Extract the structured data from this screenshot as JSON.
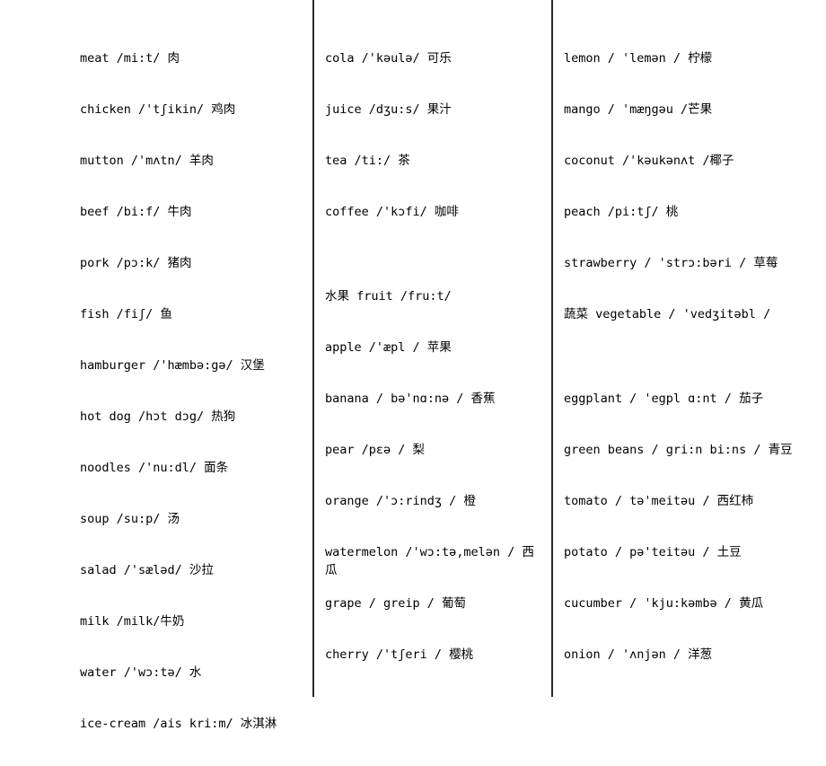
{
  "document": {
    "type": "vocabulary-word-list",
    "background_color": "#ffffff",
    "text_color": "#000000",
    "divider_color": "#2b2b2b",
    "column_count": 3
  },
  "columns": [
    {
      "name": "food-meat-and-dishes",
      "entries": [
        {
          "word": "meat",
          "text": "meat    /mi:t/ 肉"
        },
        {
          "word": "chicken",
          "text": "chicken    /'tʃikin/ 鸡肉"
        },
        {
          "word": "mutton",
          "text": "mutton    /'mʌtn/ 羊肉"
        },
        {
          "word": "beef",
          "text": "beef    /bi:f/ 牛肉"
        },
        {
          "word": "pork",
          "text": "pork    /pɔ:k/ 猪肉"
        },
        {
          "word": "fish",
          "text": "fish    /fiʃ/ 鱼"
        },
        {
          "word": "hamburger",
          "text": "hamburger    /'hæmbə:gə/ 汉堡"
        },
        {
          "word": "hot dog",
          "text": "hot dog    /hɔt dɔg/ 热狗"
        },
        {
          "word": "noodles",
          "text": "noodles    /'nu:dl/ 面条"
        },
        {
          "word": "soup",
          "text": "soup    /su:p/ 汤"
        },
        {
          "word": "salad",
          "text": "salad    /'sæləd/ 沙拉"
        },
        {
          "word": "milk",
          "text": "milk    /milk/牛奶"
        },
        {
          "word": "water",
          "text": "water    /'wɔ:tə/ 水"
        },
        {
          "word": "ice-cream",
          "text": " ice-cream    /ais kri:m/ 冰淇淋"
        }
      ]
    },
    {
      "name": "drinks-and-fruit",
      "entries": [
        {
          "word": "cola",
          "text": "cola    /'kəulə/ 可乐"
        },
        {
          "word": "juice",
          "text": "juice    /dʒu:s/ 果汁"
        },
        {
          "word": "tea",
          "text": "tea    /ti:/ 茶"
        },
        {
          "word": "coffee",
          "text": "coffee    /'kɔfi/ 咖啡"
        },
        {
          "word": "",
          "text": ""
        },
        {
          "word": "fruit",
          "text": "水果 fruit  /fru:t/"
        },
        {
          "word": "apple",
          "text": "apple     /'æpl / 苹果"
        },
        {
          "word": "banana",
          "text": "banana    / bə'nɑ:nə / 香蕉"
        },
        {
          "word": "pear",
          "text": "pear    /pɛə / 梨"
        },
        {
          "word": "orange",
          "text": "orange    /'ɔ:rindʒ / 橙"
        },
        {
          "word": "watermelon",
          "text": "watermelon    /'wɔ:tə,melən / 西瓜"
        },
        {
          "word": "grape",
          "text": "grape    / greip / 葡萄"
        },
        {
          "word": "cherry",
          "text": "cherry   /'tʃeri / 樱桃"
        }
      ]
    },
    {
      "name": "fruit-and-vegetables",
      "entries": [
        {
          "word": "lemon",
          "text": "lemon    / 'lemən / 柠檬"
        },
        {
          "word": "mango",
          "text": "mango    / 'mæŋgəu /芒果"
        },
        {
          "word": "coconut",
          "text": "coconut    /'kəukənʌt /椰子"
        },
        {
          "word": "peach",
          "text": "peach    /pi:tʃ/ 桃"
        },
        {
          "word": "strawberry",
          "text": "strawberry    / 'strɔ:bəri / 草莓"
        },
        {
          "word": "vegetable",
          "text": "蔬菜 vegetable / 'vedʒitəbl /"
        },
        {
          "word": "",
          "text": ""
        },
        {
          "word": "eggplant",
          "text": "eggplant  / 'egpl ɑ:nt / 茄子"
        },
        {
          "word": "green beans",
          "text": "green beans  / gri:n bi:ns / 青豆"
        },
        {
          "word": "tomato",
          "text": "tomato  / tə'meitəu / 西红柿"
        },
        {
          "word": "potato",
          "text": "potato  / pə'teitəu / 土豆"
        },
        {
          "word": "cucumber",
          "text": "cucumber   / 'kju:kəmbə / 黄瓜"
        },
        {
          "word": "onion",
          "text": "onion    / 'ʌnjən / 洋葱"
        }
      ]
    }
  ]
}
